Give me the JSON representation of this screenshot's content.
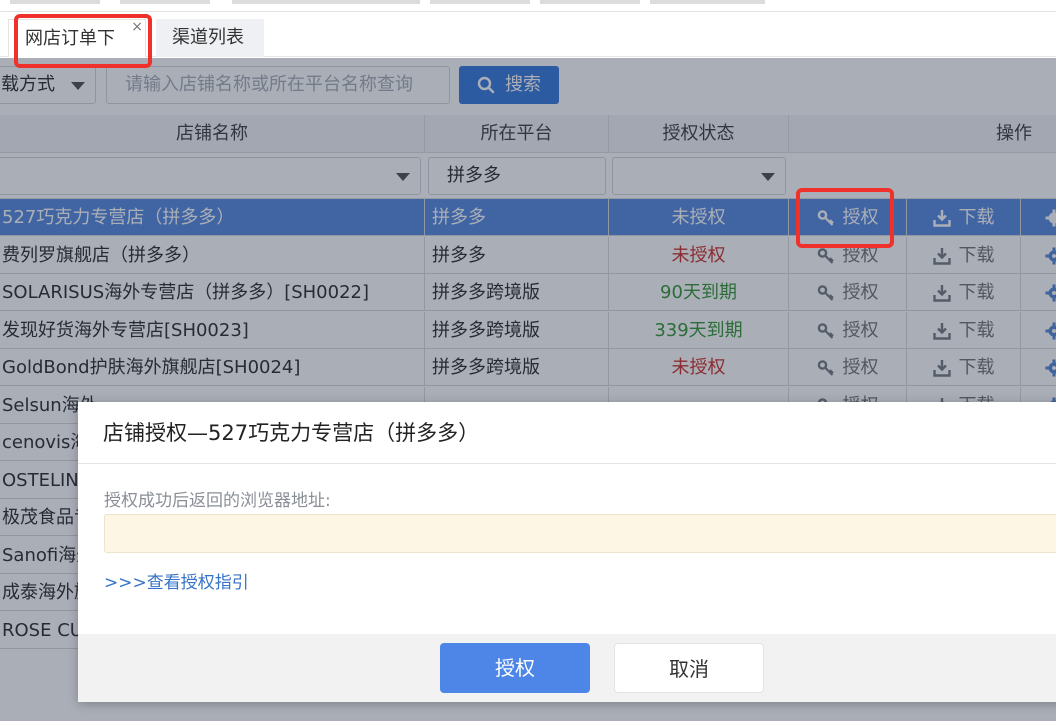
{
  "tabs": [
    {
      "label": "网店订单下载",
      "close": "×"
    },
    {
      "label": "渠道列表"
    }
  ],
  "filter": {
    "method_select": "载方式",
    "search_placeholder": "请输入店铺名称或所在平台名称查询",
    "search_button": "搜索"
  },
  "table": {
    "headers": {
      "name": "店铺名称",
      "platform": "所在平台",
      "status": "授权状态",
      "actions": "操作"
    },
    "filter_platform": "拼多多",
    "auth_label": "授权",
    "download_label": "下载",
    "rows": [
      {
        "name": "527巧克力专营店（拼多多）",
        "platform": "拼多多",
        "status": "未授权"
      },
      {
        "name": "费列罗旗舰店（拼多多）",
        "platform": "拼多多",
        "status": "未授权"
      },
      {
        "name": "SOLARISUS海外专营店（拼多多）[SH0022]",
        "platform": "拼多多跨境版",
        "status": "90天到期"
      },
      {
        "name": "发现好货海外专营店[SH0023]",
        "platform": "拼多多跨境版",
        "status": "339天到期"
      },
      {
        "name": "GoldBond护肤海外旗舰店[SH0024]",
        "platform": "拼多多跨境版",
        "status": "未授权"
      },
      {
        "name": "Selsun海外",
        "platform": "",
        "status": ""
      },
      {
        "name": "cenovis海",
        "platform": "",
        "status": ""
      },
      {
        "name": "OSTELIN",
        "platform": "",
        "status": ""
      },
      {
        "name": "极茂食品专",
        "platform": "",
        "status": ""
      },
      {
        "name": "Sanofi海外",
        "platform": "",
        "status": ""
      },
      {
        "name": "成泰海外旗",
        "platform": "",
        "status": ""
      },
      {
        "name": "ROSE CU",
        "platform": "",
        "status": ""
      }
    ]
  },
  "modal": {
    "title": "店铺授权—527巧克力专营店（拼多多）",
    "label": "授权成功后返回的浏览器地址:",
    "link": ">>>查看授权指引",
    "ok_button": "授权",
    "cancel_button": "取消"
  },
  "colors": {
    "accent": "#3b7ddd",
    "selected_row": "#5b8de0",
    "highlight_box": "#f0302a",
    "status_red": "#d0342c",
    "status_green": "#3a9a3a"
  }
}
